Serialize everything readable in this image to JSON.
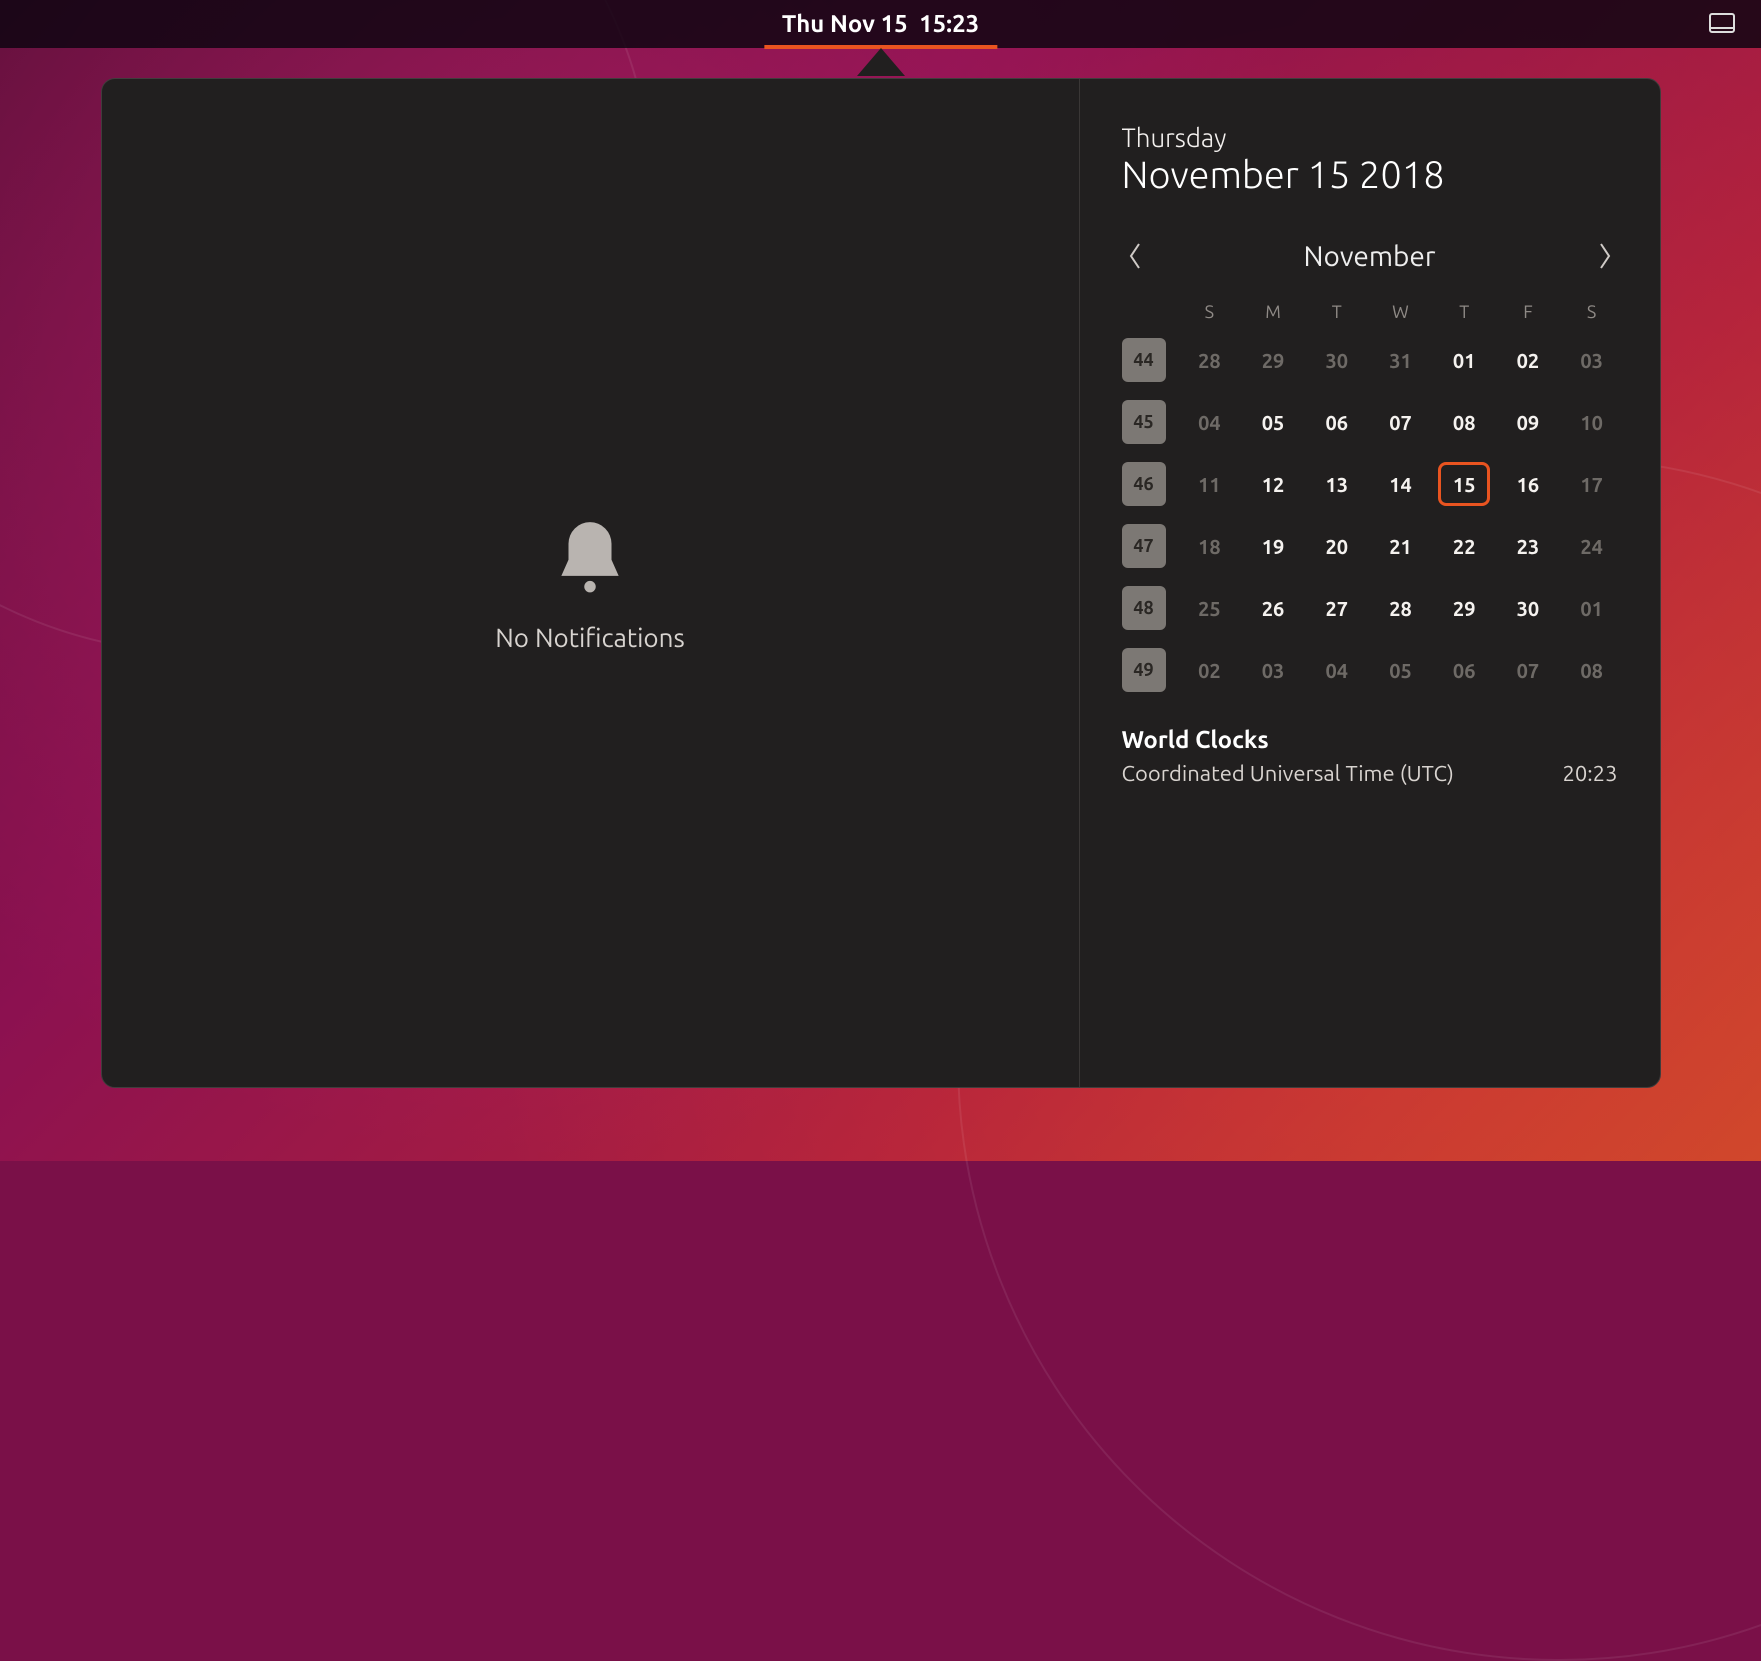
{
  "topbar": {
    "clock_text": "Thu Nov 15  15:23",
    "tray": {
      "workspace_icon": "monitor-icon"
    }
  },
  "notifications": {
    "empty_message": "No Notifications"
  },
  "calendar": {
    "day_name": "Thursday",
    "date_full": "November 15 2018",
    "month_label": "November",
    "dow": [
      "S",
      "M",
      "T",
      "W",
      "T",
      "F",
      "S"
    ],
    "today_day": 15,
    "weeks": [
      {
        "wn": "44",
        "days": [
          {
            "n": "28",
            "t": "out"
          },
          {
            "n": "29",
            "t": "out"
          },
          {
            "n": "30",
            "t": "out"
          },
          {
            "n": "31",
            "t": "out"
          },
          {
            "n": "01",
            "t": "in"
          },
          {
            "n": "02",
            "t": "in"
          },
          {
            "n": "03",
            "t": "sat"
          }
        ]
      },
      {
        "wn": "45",
        "days": [
          {
            "n": "04",
            "t": "out"
          },
          {
            "n": "05",
            "t": "in"
          },
          {
            "n": "06",
            "t": "in"
          },
          {
            "n": "07",
            "t": "in"
          },
          {
            "n": "08",
            "t": "in"
          },
          {
            "n": "09",
            "t": "in"
          },
          {
            "n": "10",
            "t": "sat"
          }
        ]
      },
      {
        "wn": "46",
        "days": [
          {
            "n": "11",
            "t": "out"
          },
          {
            "n": "12",
            "t": "in"
          },
          {
            "n": "13",
            "t": "in"
          },
          {
            "n": "14",
            "t": "in"
          },
          {
            "n": "15",
            "t": "in",
            "today": true
          },
          {
            "n": "16",
            "t": "in"
          },
          {
            "n": "17",
            "t": "sat"
          }
        ]
      },
      {
        "wn": "47",
        "days": [
          {
            "n": "18",
            "t": "out"
          },
          {
            "n": "19",
            "t": "in"
          },
          {
            "n": "20",
            "t": "in"
          },
          {
            "n": "21",
            "t": "in"
          },
          {
            "n": "22",
            "t": "in"
          },
          {
            "n": "23",
            "t": "in"
          },
          {
            "n": "24",
            "t": "sat"
          }
        ]
      },
      {
        "wn": "48",
        "days": [
          {
            "n": "25",
            "t": "out"
          },
          {
            "n": "26",
            "t": "in"
          },
          {
            "n": "27",
            "t": "in"
          },
          {
            "n": "28",
            "t": "in"
          },
          {
            "n": "29",
            "t": "in"
          },
          {
            "n": "30",
            "t": "in"
          },
          {
            "n": "01",
            "t": "sat"
          }
        ]
      },
      {
        "wn": "49",
        "days": [
          {
            "n": "02",
            "t": "out"
          },
          {
            "n": "03",
            "t": "out"
          },
          {
            "n": "04",
            "t": "out"
          },
          {
            "n": "05",
            "t": "out"
          },
          {
            "n": "06",
            "t": "out"
          },
          {
            "n": "07",
            "t": "out"
          },
          {
            "n": "08",
            "t": "out"
          }
        ]
      }
    ]
  },
  "world_clocks": {
    "heading": "World Clocks",
    "rows": [
      {
        "label": "Coordinated Universal Time (UTC)",
        "time": "20:23"
      }
    ]
  },
  "colors": {
    "accent": "#e95420"
  }
}
